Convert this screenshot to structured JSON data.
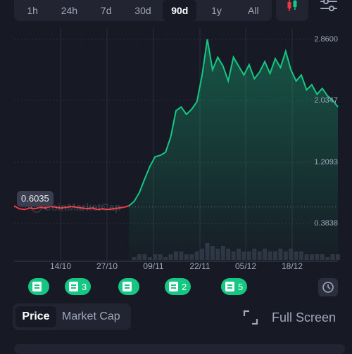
{
  "ranges": [
    "1h",
    "24h",
    "7d",
    "30d",
    "90d",
    "1y",
    "All"
  ],
  "active_range": "90d",
  "y_axis_labels": [
    "2.8600",
    "2.0347",
    "1.2093",
    "0.3838"
  ],
  "x_axis_labels": [
    "14/10",
    "27/10",
    "09/11",
    "22/11",
    "05/12",
    "18/12"
  ],
  "current_price_tag": "0.6035",
  "watermark": "CoinMarketCap",
  "news_markers": [
    {
      "count": ""
    },
    {
      "count": "3"
    },
    {
      "count": ""
    },
    {
      "count": "2"
    },
    {
      "count": "5"
    }
  ],
  "tabs": {
    "price": "Price",
    "market_cap": "Market Cap"
  },
  "full_screen_label": "Full Screen",
  "colors": {
    "up": "#16c784",
    "down": "#ea3943",
    "background": "#171924",
    "panel": "#222531"
  },
  "chart_data": {
    "type": "line",
    "ylim": [
      0.3838,
      2.86
    ],
    "x_ticks": [
      "14/10",
      "27/10",
      "09/11",
      "22/11",
      "05/12",
      "18/12"
    ],
    "reference_value": 0.6035,
    "series": [
      {
        "values": [
          0.62,
          0.58,
          0.57,
          0.59,
          0.58,
          0.6,
          0.59,
          0.61,
          0.6,
          0.59,
          0.6,
          0.61,
          0.6,
          0.59,
          0.58,
          0.59,
          0.57,
          0.58,
          0.57,
          0.58,
          0.59,
          0.6,
          0.62,
          0.68,
          0.8,
          0.98,
          1.15,
          1.28,
          1.3,
          1.34,
          1.55,
          1.9,
          1.95,
          1.85,
          1.92,
          2.02,
          2.38,
          2.86,
          2.45,
          2.62,
          2.5,
          2.3,
          2.62,
          2.5,
          2.38,
          2.52,
          2.33,
          2.42,
          2.56,
          2.4,
          2.6,
          2.48,
          2.7,
          2.45,
          2.3,
          2.38,
          2.18,
          2.25,
          2.12,
          2.2,
          2.1,
          2.04,
          1.95
        ]
      }
    ],
    "volume": [
      0,
      0,
      0,
      0,
      0,
      0,
      0,
      0,
      0,
      0,
      0,
      0,
      0,
      0,
      0,
      0,
      0,
      0,
      0,
      0,
      0,
      0,
      0,
      1,
      2,
      2,
      1,
      2,
      2,
      1,
      2,
      3,
      3,
      2,
      2,
      3,
      4,
      6,
      5,
      4,
      5,
      4,
      3,
      4,
      3,
      3,
      4,
      3,
      4,
      3,
      3,
      4,
      3,
      4,
      3,
      3,
      2,
      2,
      2,
      2,
      1,
      2,
      2
    ]
  }
}
